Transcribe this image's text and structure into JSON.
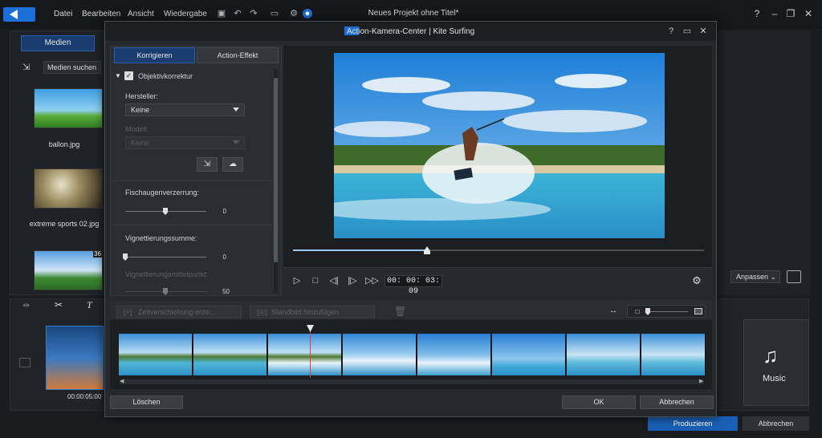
{
  "app": {
    "menu": [
      "Datei",
      "Bearbeiten",
      "Ansicht",
      "Wiedergabe"
    ],
    "title": "Neues Projekt ohne Titel*",
    "help": "?",
    "media_tab": "Medien",
    "media_search": "Medien suchen",
    "thumbs": [
      {
        "label": "ballon.jpg"
      },
      {
        "label": "extreme sports 02.jpg"
      },
      {
        "label": ""
      }
    ],
    "thumb3_badge": "36",
    "fit_select": "Anpassen",
    "clip_time": "00:00:05:00",
    "music_label": "Music",
    "produce_button": "Produzieren",
    "cancel_button": "Abbrechen"
  },
  "dialog": {
    "title": "Action-Kamera-Center  |  Kite Surfing",
    "help": "?",
    "tabs": [
      "Korrigieren",
      "Action-Effekt"
    ],
    "lens_correction": {
      "label": "Objektivkorrektur",
      "checked": true,
      "manufacturer_label": "Hersteller:",
      "manufacturer_value": "Keine",
      "model_label": "Modell:",
      "model_value": "Keine"
    },
    "fisheye": {
      "label": "Fischaugenverzerrung:",
      "value": "0"
    },
    "vignette_amount": {
      "label": "Vignettierungssumme:",
      "value": "0"
    },
    "vignette_center": {
      "label": "Vignettierungsmittelpunkt:",
      "value": "50"
    },
    "playback": {
      "timecode": "00: 00: 03: 09",
      "position_fraction": 0.33
    },
    "strip_buttons": [
      "Zeitverschiebung erze...",
      "Standbild hinzufügen"
    ],
    "buttons": {
      "delete": "Löschen",
      "ok": "OK",
      "cancel": "Abbrechen"
    }
  }
}
